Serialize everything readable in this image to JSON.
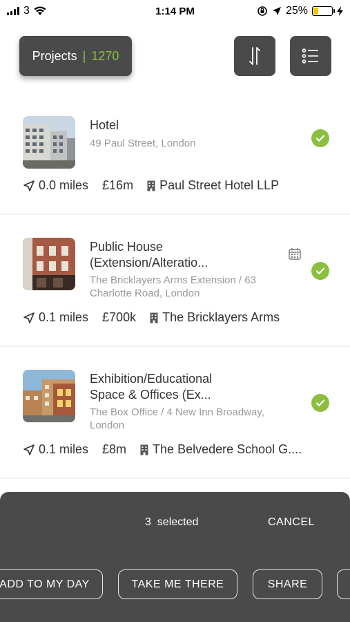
{
  "status_bar": {
    "carrier": "3",
    "time": "1:14 PM",
    "battery": "25%",
    "battery_level": 0.25
  },
  "header": {
    "projects_label": "Projects",
    "separator": "|",
    "projects_count": "1270",
    "sort_icon": "sort-arrows-icon",
    "list_icon": "list-icon"
  },
  "projects": [
    {
      "title": "Hotel",
      "address": "49 Paul Street, London",
      "distance": "0.0 miles",
      "value": "£16m",
      "company": "Paul Street Hotel LLP",
      "selected": true,
      "has_calendar": false
    },
    {
      "title": "Public House (Extension/Alteratio...",
      "address": "The Bricklayers Arms Extension / 63 Charlotte Road, London",
      "distance": "0.1 miles",
      "value": "£700k",
      "company": "The Bricklayers Arms",
      "selected": true,
      "has_calendar": true
    },
    {
      "title": "Exhibition/Educational Space & Offices (Ex...",
      "address": "The Box Office / 4 New Inn Broadway, London",
      "distance": "0.1 miles",
      "value": "£8m",
      "company": "The Belvedere School G....",
      "selected": true,
      "has_calendar": false
    }
  ],
  "selection_bar": {
    "selected_text": "3  selected",
    "cancel_label": "CANCEL",
    "actions": [
      "ADD TO MY DAY",
      "TAKE ME THERE",
      "SHARE",
      ""
    ]
  },
  "colors": {
    "accent": "#8bbf3f",
    "dark": "#4a4a4a",
    "muted_text": "#999999"
  }
}
